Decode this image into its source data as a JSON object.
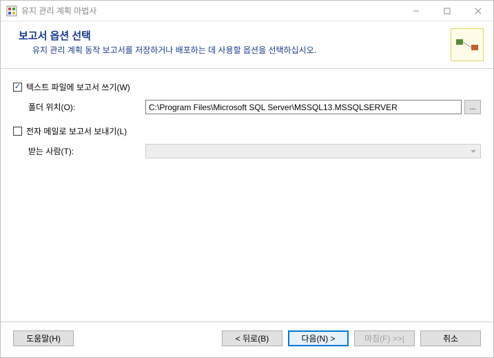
{
  "window": {
    "title": "유지 관리 계획 마법사"
  },
  "header": {
    "title": "보고서 옵션 선택",
    "subtitle": "유지 관리 계획 동작 보고서를 저장하거나 배포하는 데 사용할 옵션을 선택하십시오."
  },
  "options": {
    "writeReport": {
      "checked": true,
      "label": "텍스트 파일에 보고서 쓰기(W)",
      "folderLabel": "폴더 위치(O):",
      "folderPath": "C:\\Program Files\\Microsoft SQL Server\\MSSQL13.MSSQLSERVER",
      "browse": "..."
    },
    "emailReport": {
      "checked": false,
      "label": "전자 메일로 보고서 보내기(L)",
      "recipientLabel": "받는 사람(T):"
    }
  },
  "footer": {
    "help": "도움말(H)",
    "back": "< 뒤로(B)",
    "next": "다음(N) >",
    "finish": "마침(F) >>|",
    "cancel": "취소"
  }
}
